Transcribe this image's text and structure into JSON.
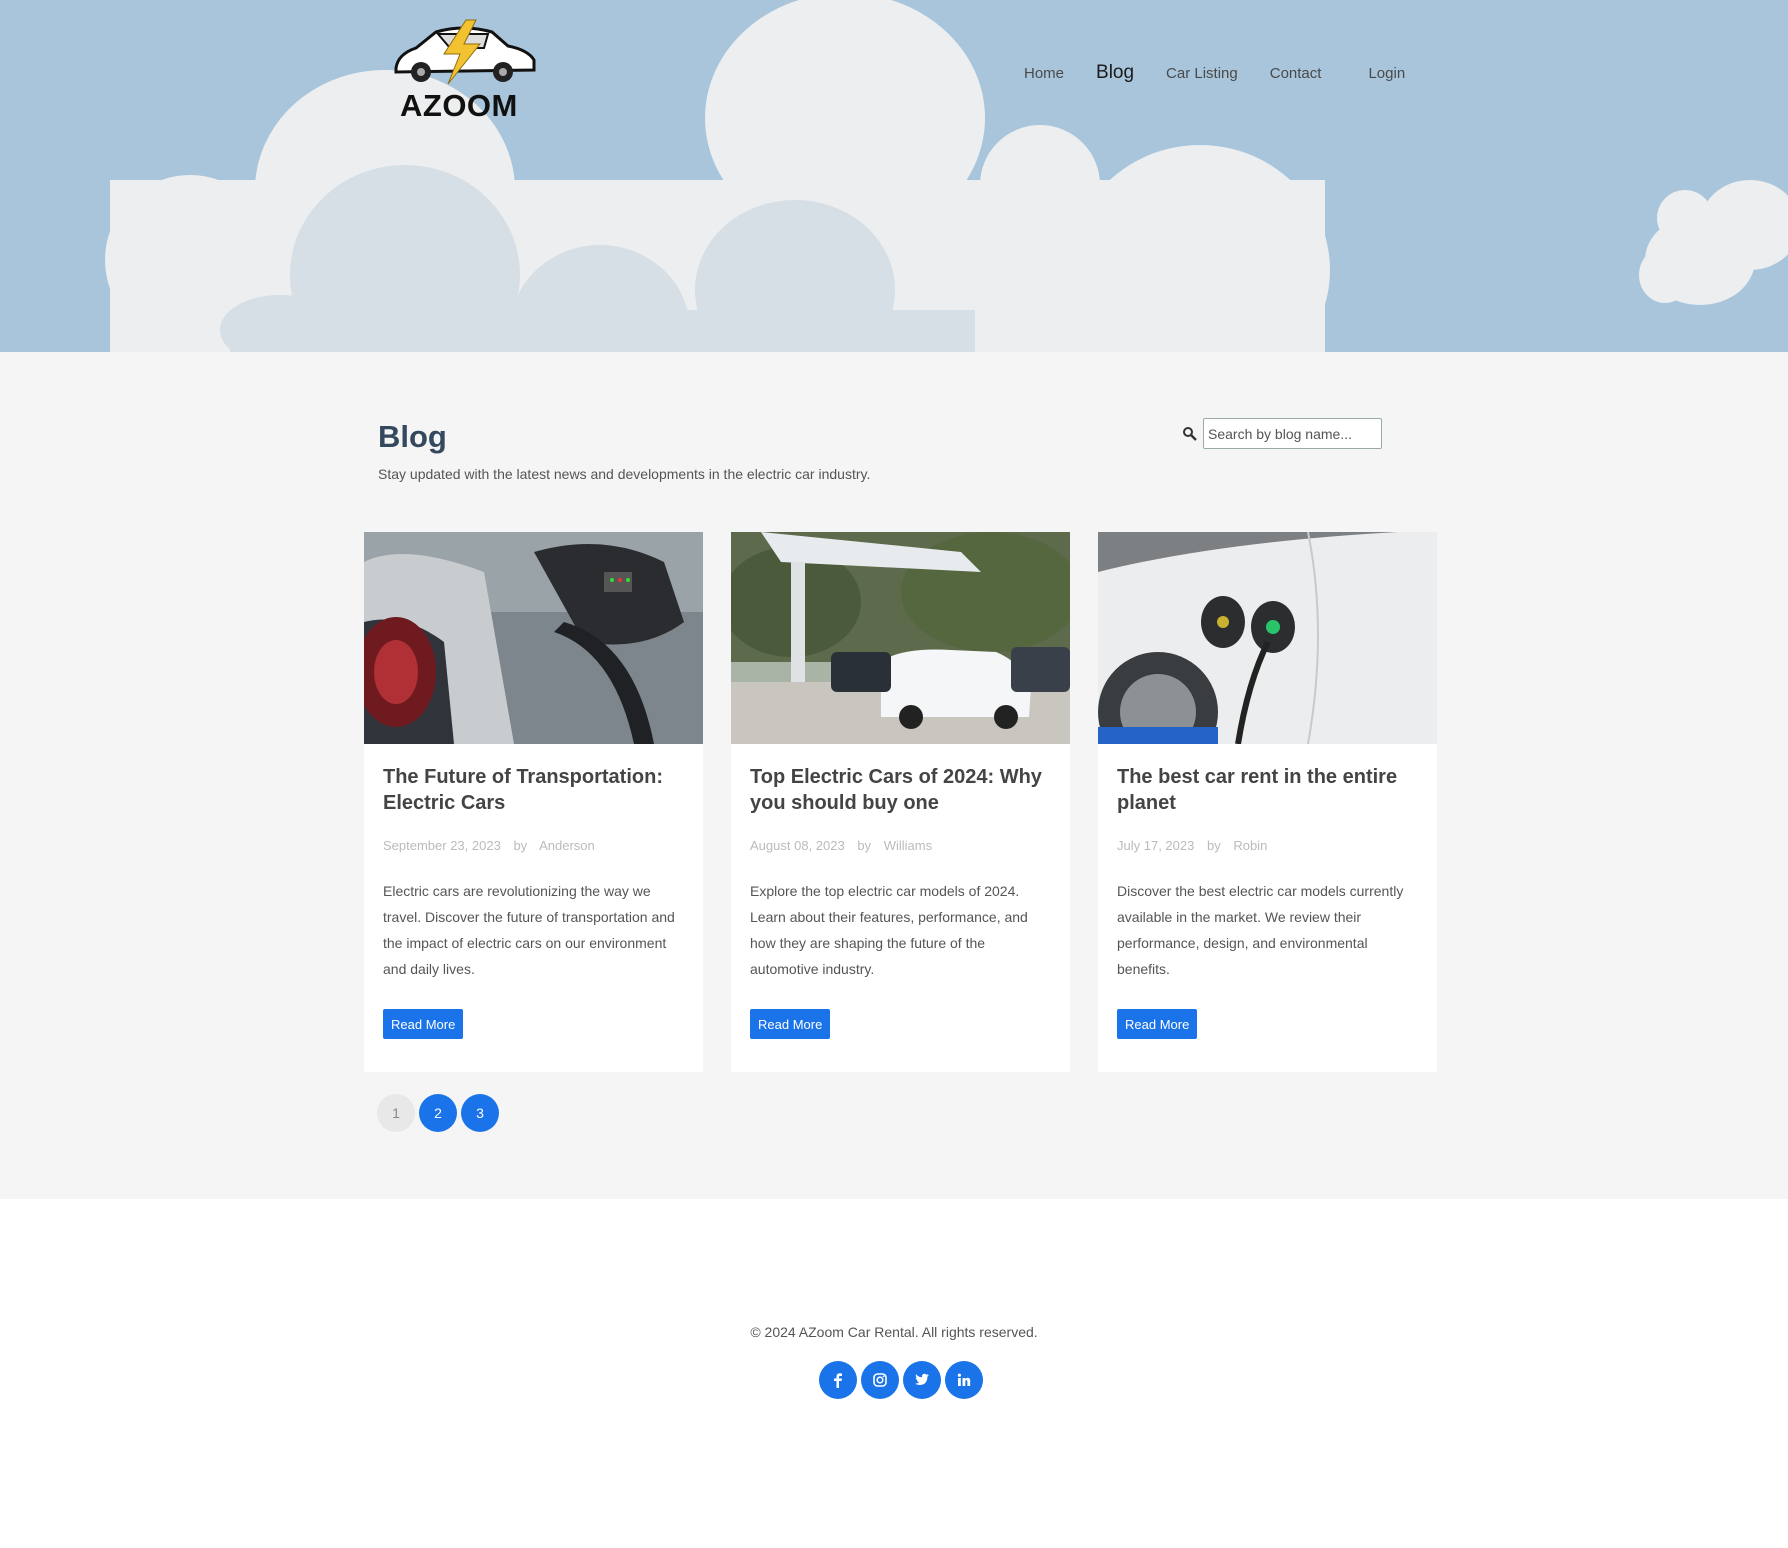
{
  "brand": {
    "name": "AZOOM"
  },
  "nav": {
    "items": [
      {
        "label": "Home",
        "active": false
      },
      {
        "label": "Blog",
        "active": true
      },
      {
        "label": "Car Listing",
        "active": false
      },
      {
        "label": "Contact",
        "active": false
      }
    ],
    "login_label": "Login"
  },
  "blog": {
    "title": "Blog",
    "subtitle": "Stay updated with the latest news and developments in the electric car industry.",
    "search": {
      "placeholder": "Search by blog name...",
      "value": "",
      "icon": "search-icon"
    },
    "posts": [
      {
        "title": "The Future of Transportation: Electric Cars",
        "date": "September 23, 2023",
        "by": "by",
        "author": "Anderson",
        "excerpt": "Electric cars are revolutionizing the way we travel. Discover the future of transportation and the impact of electric cars on our environment and daily lives.",
        "button": "Read More"
      },
      {
        "title": "Top Electric Cars of 2024: Why you should buy one",
        "date": "August 08, 2023",
        "by": "by",
        "author": "Williams",
        "excerpt": "Explore the top electric car models of 2024. Learn about their features, performance, and how they are shaping the future of the automotive industry.",
        "button": "Read More"
      },
      {
        "title": "The best car rent in the entire planet",
        "date": "July 17, 2023",
        "by": "by",
        "author": "Robin",
        "excerpt": "Discover the best electric car models currently available in the market. We review their performance, design, and environmental benefits.",
        "button": "Read More"
      }
    ],
    "pagination": {
      "pages": [
        "1",
        "2",
        "3"
      ],
      "current": "1"
    }
  },
  "footer": {
    "copyright": "© 2024 AZoom Car Rental. All rights reserved.",
    "socials": [
      "facebook-icon",
      "instagram-icon",
      "twitter-icon",
      "linkedin-icon"
    ]
  },
  "colors": {
    "sky": "#a8c5dc",
    "cloud": "#eceeef",
    "accent": "#1a73e8",
    "title": "#34495e"
  }
}
